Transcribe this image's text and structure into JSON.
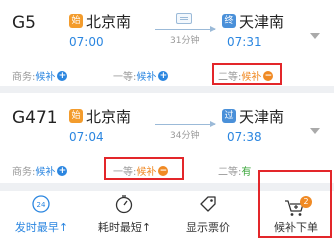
{
  "trains": [
    {
      "train_no": "G5",
      "from_badge": "始",
      "from_station": "北京南",
      "depart_time": "07:00",
      "duration": "31分钟",
      "to_badge": "终",
      "to_station": "天津南",
      "arrive_time": "07:31",
      "seats": [
        {
          "class_label": "商务:",
          "status": "候补",
          "action": "+"
        },
        {
          "class_label": "一等:",
          "status": "候补",
          "action": "+"
        },
        {
          "class_label": "二等:",
          "status": "候补",
          "action": "−"
        }
      ]
    },
    {
      "train_no": "G471",
      "from_badge": "始",
      "from_station": "北京南",
      "depart_time": "07:04",
      "duration": "34分钟",
      "to_badge": "过",
      "to_station": "天津南",
      "arrive_time": "07:38",
      "seats": [
        {
          "class_label": "商务:",
          "status": "候补",
          "action": "+"
        },
        {
          "class_label": "一等:",
          "status": "候补",
          "action": "−"
        },
        {
          "class_label": "二等:",
          "status": "有",
          "action": ""
        }
      ]
    }
  ],
  "toolbar": {
    "items": [
      {
        "label": "发时最早↑",
        "icon": "clock-24-icon"
      },
      {
        "label": "耗时最短↑",
        "icon": "timer-icon"
      },
      {
        "label": "显示票价",
        "icon": "price-tag-icon"
      },
      {
        "label": "候补下单",
        "icon": "cart-icon",
        "badge": "2"
      }
    ]
  },
  "colors": {
    "accent_blue": "#2b86e0",
    "waitlist_orange": "#f08a24",
    "available_green": "#3aa63a",
    "highlight_red": "#e3262a"
  }
}
